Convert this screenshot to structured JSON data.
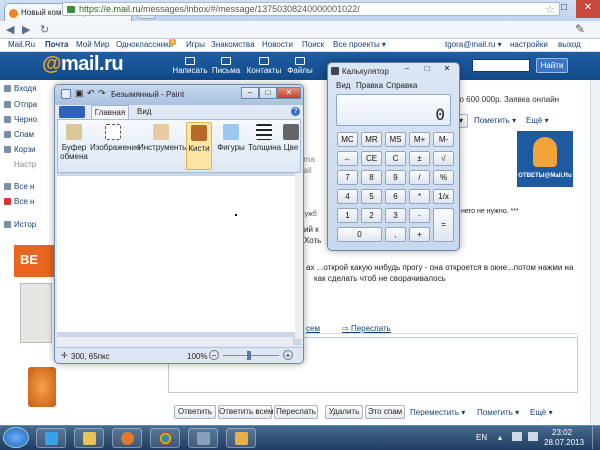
{
  "browser": {
    "tab_title": "Новый комментарий в О",
    "tab_close": "×",
    "url_scheme": "https://",
    "url_host": "e.mail.ru",
    "url_path": "/messages/inbox/#/message/13750308240000001022/",
    "back": "◀",
    "forward": "▶",
    "reload": "↻",
    "wrench": "✎",
    "window_min": "–",
    "window_max": "□",
    "window_close": "✕"
  },
  "mailnav": {
    "items": [
      "Mail.Ru",
      "Почта",
      "Мой Мир",
      "Одноклассники",
      "Игры",
      "Знакомства",
      "Новости",
      "Поиск",
      "Все проекты ▾"
    ],
    "ok_badge": "1",
    "user": "tgora@mail.ru ▾",
    "settings": "настройки",
    "logout": "выход"
  },
  "mailhead": {
    "logo_at": "@",
    "logo_text": "mail.ru",
    "buttons": [
      "Написать",
      "Письма",
      "Контакты",
      "Файлы"
    ],
    "search_btn": "Найти"
  },
  "leftcol": {
    "items": [
      "Входя",
      "Отпра",
      "Черно",
      "Спам",
      "Корзи",
      "Настр"
    ],
    "more1": "Все н",
    "more2": "Все н",
    "history": "Истор",
    "ad_text": "ВЕ"
  },
  "message": {
    "subject_tail": "До 600 000р. Заявка онлайн",
    "toolbar1": [
      "▾",
      "Пометить ▾",
      "Ещё ▾"
    ],
    "otveti_label": "ОТВЕТЫ@Mail.Ru",
    "snippet": [
      "р.ma",
      "mail",
      "",
      "служб",
      "ий к",
      "Хоть"
    ],
    "line1": "него не нужно. ***",
    "line2": "ах ...открой какую нибудь прогу - она откроется в окне...потом нажми на",
    "line3": "как сделать чтоб не сворачивалось",
    "reply_all": "сем",
    "forward": "Переслать",
    "toolbar2": [
      "Ответить",
      "Ответить всем",
      "Переслать",
      "Удалить",
      "Это спам",
      "Переместить ▾",
      "Пометить ▾",
      "Ещё ▾"
    ]
  },
  "paint": {
    "title": "Безымянный - Paint",
    "tab_home": "Главная",
    "tab_view": "Вид",
    "groups": [
      "Буфер обмена",
      "Изображение",
      "Инструменты",
      "Кисти",
      "Фигуры",
      "Толщина",
      "Цве"
    ],
    "status_coords": "300, 65пкс",
    "zoom": "100%",
    "zoom_minus": "−",
    "zoom_plus": "+"
  },
  "calc": {
    "title": "Калькулятор",
    "menu": [
      "Вид",
      "Правка",
      "Справка"
    ],
    "display": "0",
    "keys": [
      [
        "MC",
        "MR",
        "MS",
        "M+",
        "M-"
      ],
      [
        "←",
        "CE",
        "C",
        "±",
        "√"
      ],
      [
        "7",
        "8",
        "9",
        "/",
        "%"
      ],
      [
        "4",
        "5",
        "6",
        "*",
        "1/x"
      ],
      [
        "1",
        "2",
        "3",
        "-",
        "="
      ],
      [
        "0",
        "",
        ",",
        "+",
        ""
      ]
    ]
  },
  "taskbar": {
    "lang": "EN",
    "time": "23:02",
    "date": "28.07.2013"
  }
}
